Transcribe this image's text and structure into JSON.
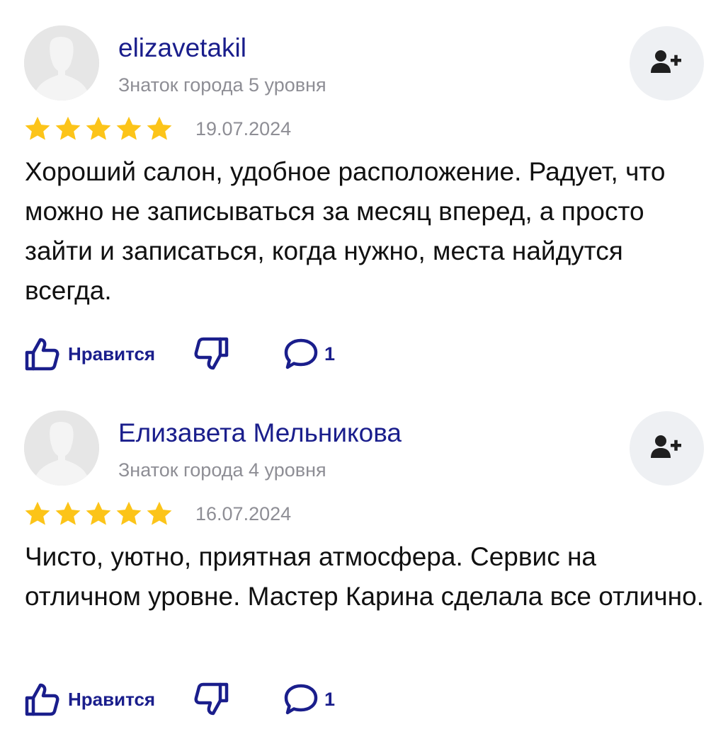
{
  "accent_color": "#1a1e8c",
  "star_color": "#fcc419",
  "reviews": [
    {
      "author": "elizavetakil",
      "level": "Знаток города 5 уровня",
      "rating": 5,
      "date": "19.07.2024",
      "text": "Хороший салон, удобное расположение. Радует, что можно не записываться за месяц вперед, а просто зайти и записаться, когда нужно, места найдутся всегда.",
      "like_label": "Нравится",
      "comment_count": "1",
      "icons": {
        "avatar": "user-silhouette-icon",
        "subscribe": "add-user-icon",
        "like": "thumbs-up-icon",
        "dislike": "thumbs-down-icon",
        "comment": "comment-bubble-icon"
      }
    },
    {
      "author": "Елизавета Мельникова",
      "level": "Знаток города 4 уровня",
      "rating": 5,
      "date": "16.07.2024",
      "text": "Чисто, уютно, приятная атмосфера. Сервис на отличном уровне. Мастер Карина сделала все отлично.",
      "like_label": "Нравится",
      "comment_count": "1",
      "icons": {
        "avatar": "user-silhouette-icon",
        "subscribe": "add-user-icon",
        "like": "thumbs-up-icon",
        "dislike": "thumbs-down-icon",
        "comment": "comment-bubble-icon"
      }
    }
  ]
}
